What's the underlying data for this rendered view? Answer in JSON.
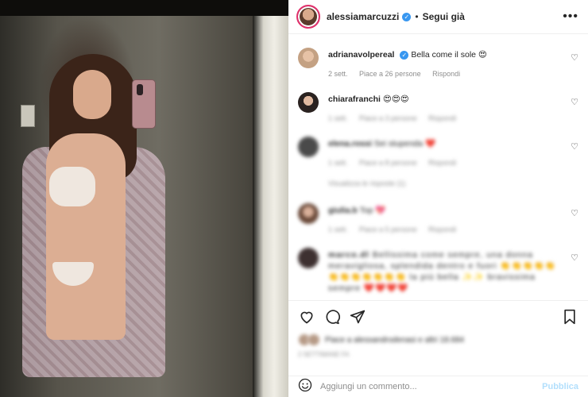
{
  "post": {
    "author": "alessiamarcuzzi",
    "dot": "•",
    "follow_label": "Segui già",
    "more_label": "•••"
  },
  "comments": [
    {
      "user": "adrianavolpereal",
      "verified": true,
      "text": "Bella come il sole 😍",
      "time": "2 sett.",
      "likes": "Piace a 26 persone",
      "reply": "Rispondi",
      "blurred": false
    },
    {
      "user": "chiarafranchi",
      "verified": false,
      "text": "😍😍😍",
      "time": "1 sett.",
      "likes": "Piace a 3 persone",
      "reply": "Rispondi",
      "blurred": true
    },
    {
      "user": "elena.rossi",
      "verified": false,
      "text": "Sei stupenda ❤️",
      "time": "1 sett.",
      "likes": "Piace a 8 persone",
      "reply": "Rispondi",
      "view_replies": "Visualizza le risposte (1)",
      "blurred": true
    },
    {
      "user": "giulia.b",
      "verified": false,
      "text": "Top 💖",
      "time": "1 sett.",
      "likes": "Piace a 5 persone",
      "reply": "Rispondi",
      "blurred": true
    },
    {
      "user": "marco.dl",
      "verified": false,
      "text": "Bellissima come sempre, una donna meravigliosa, splendida dentro e fuori 👏👏👏👏👏👏👏👏👏👏👏👏 la più bella ✨✨ bravissima sempre ❤️❤️❤️❤️",
      "time": "",
      "likes": "",
      "reply": "",
      "blurred": true
    }
  ],
  "footer": {
    "liked_by": "Piace a alessandrodenasi e altri 18.684",
    "date": "2 SETTIMANE FA",
    "comment_placeholder": "Aggiungi un commento...",
    "publish_label": "Pubblica"
  },
  "colors": {
    "verified": "#3897f0",
    "publish_disabled": "#b2dffc",
    "story_ring": "#e1306c"
  },
  "icons": [
    "heart-icon",
    "comment-icon",
    "share-icon",
    "save-icon",
    "emoji-icon",
    "more-icon",
    "verified-icon"
  ]
}
